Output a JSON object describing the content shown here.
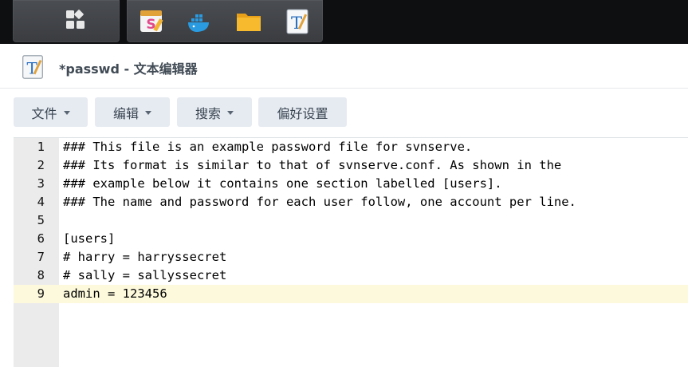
{
  "taskbar": {
    "icons": [
      "grid-menu-icon",
      "sketch-app-icon",
      "docker-icon",
      "folder-icon",
      "text-editor-icon"
    ]
  },
  "window": {
    "title": "*passwd - 文本编辑器",
    "app_icon": "text-editor-icon"
  },
  "toolbar": {
    "file_label": "文件",
    "edit_label": "编辑",
    "search_label": "搜索",
    "prefs_label": "偏好设置"
  },
  "editor": {
    "active_line": 9,
    "lines": [
      {
        "num": "1",
        "text": "### This file is an example password file for svnserve."
      },
      {
        "num": "2",
        "text": "### Its format is similar to that of svnserve.conf. As shown in the"
      },
      {
        "num": "3",
        "text": "### example below it contains one section labelled [users]."
      },
      {
        "num": "4",
        "text": "### The name and password for each user follow, one account per line."
      },
      {
        "num": "5",
        "text": ""
      },
      {
        "num": "6",
        "text": "[users]"
      },
      {
        "num": "7",
        "text": "# harry = harryssecret"
      },
      {
        "num": "8",
        "text": "# sally = sallyssecret"
      },
      {
        "num": "9",
        "text": "admin = 123456"
      }
    ]
  },
  "colors": {
    "taskbar_bg": "#0e0f11",
    "button_bg": "#e6ebf1",
    "gutter_bg": "#ebebeb",
    "active_line_bg": "#fdf9dc"
  }
}
